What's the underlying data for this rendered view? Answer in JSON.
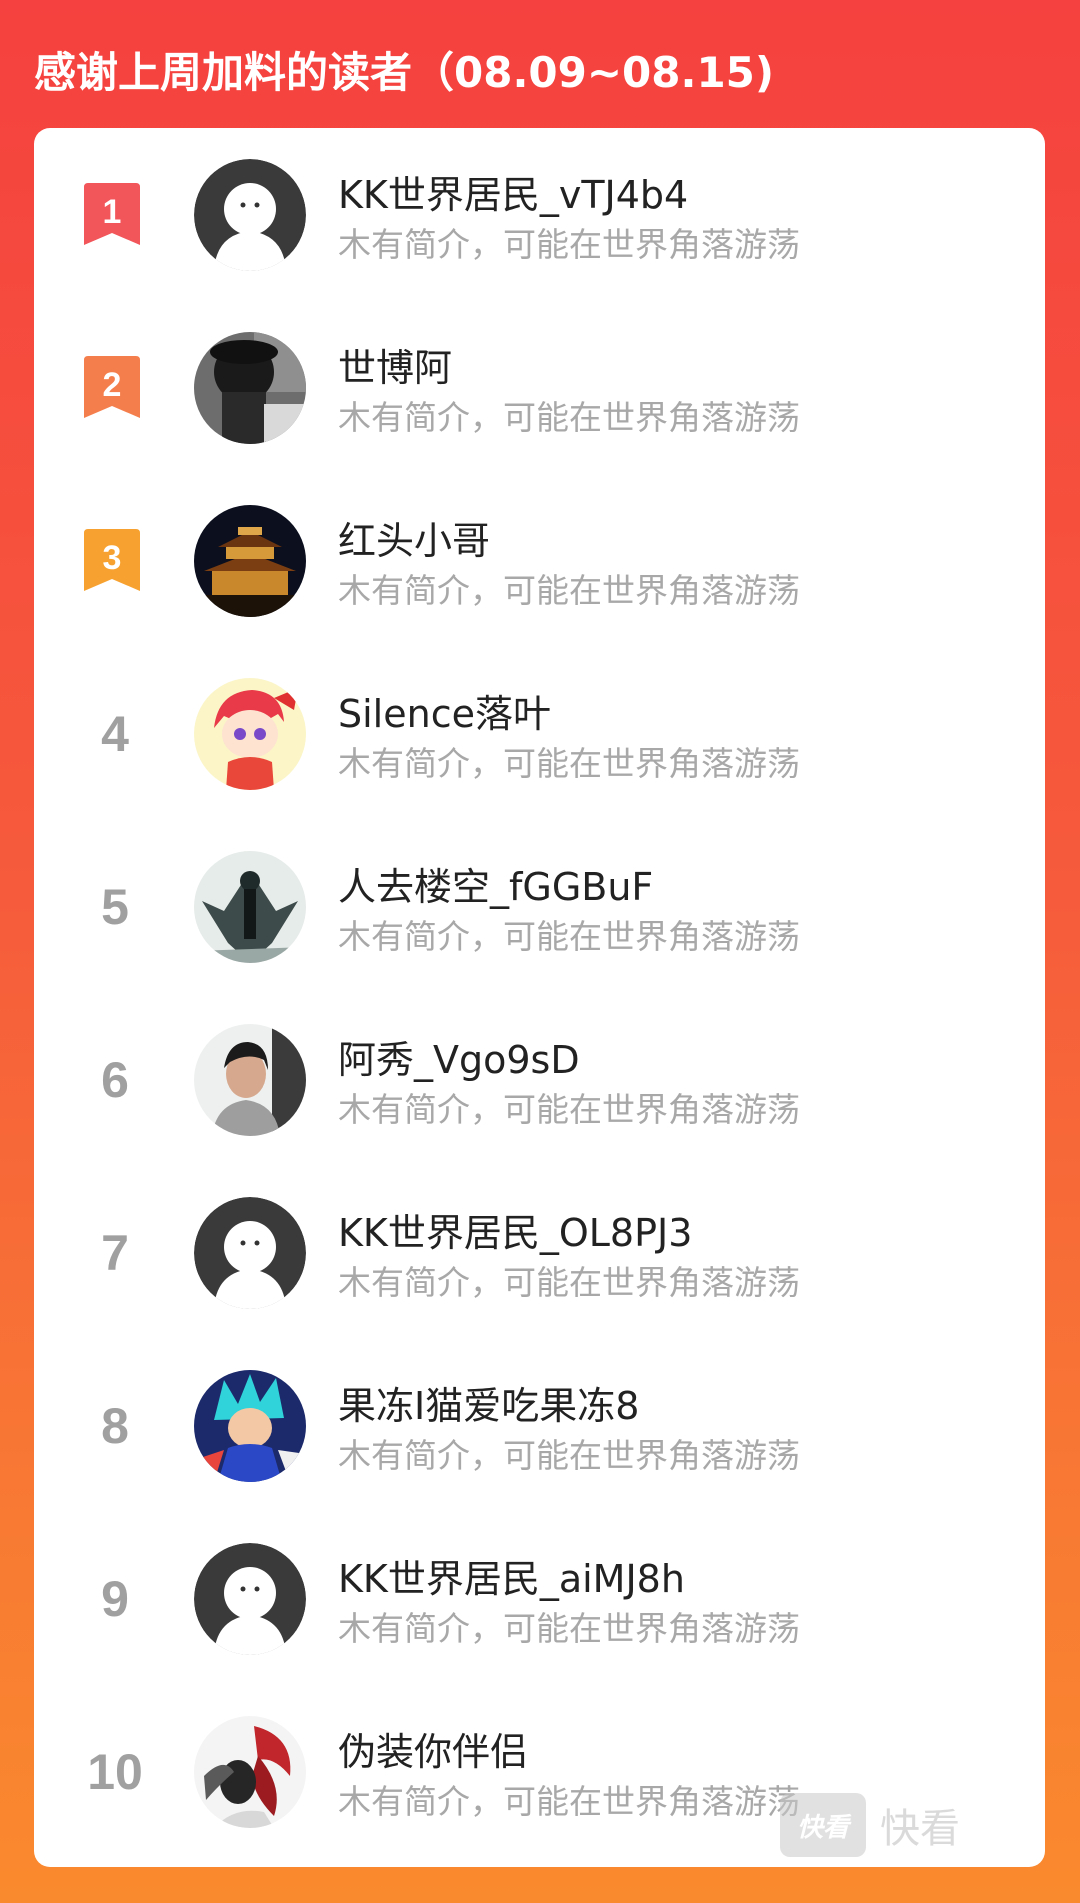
{
  "header": {
    "title": "感谢上周加料的读者（08.09~08.15)"
  },
  "colors": {
    "rank1": "#f2555a",
    "rank2": "#f57f4c",
    "rank3": "#f7a230",
    "rank_plain": "#a0a0a0"
  },
  "readers": [
    {
      "rank": "1",
      "name": "KK世界居民_vTJ4b4",
      "bio": "木有简介，可能在世界角落游荡",
      "avatar": "default-avatar-icon"
    },
    {
      "rank": "2",
      "name": "世博阿",
      "bio": "木有简介，可能在世界角落游荡",
      "avatar": "photo-avatar"
    },
    {
      "rank": "3",
      "name": "红头小哥",
      "bio": "木有简介，可能在世界角落游荡",
      "avatar": "tower-avatar"
    },
    {
      "rank": "4",
      "name": "Silence落叶",
      "bio": "木有简介，可能在世界角落游荡",
      "avatar": "cartoon-avatar"
    },
    {
      "rank": "5",
      "name": "人去楼空_fGGBuF",
      "bio": "木有简介，可能在世界角落游荡",
      "avatar": "art-avatar"
    },
    {
      "rank": "6",
      "name": "阿秀_Vgo9sD",
      "bio": "木有简介，可能在世界角落游荡",
      "avatar": "photo-avatar"
    },
    {
      "rank": "7",
      "name": "KK世界居民_OL8PJ3",
      "bio": "木有简介，可能在世界角落游荡",
      "avatar": "default-avatar-icon"
    },
    {
      "rank": "8",
      "name": "果冻I猫爱吃果冻8",
      "bio": "木有简介，可能在世界角落游荡",
      "avatar": "anime-avatar"
    },
    {
      "rank": "9",
      "name": "KK世界居民_aiMJ8h",
      "bio": "木有简介，可能在世界角落游荡",
      "avatar": "default-avatar-icon"
    },
    {
      "rank": "10",
      "name": "伪装你伴侣",
      "bio": "木有简介，可能在世界角落游荡",
      "avatar": "art-avatar"
    }
  ],
  "watermark": {
    "logo": "快看",
    "text": "快看"
  }
}
